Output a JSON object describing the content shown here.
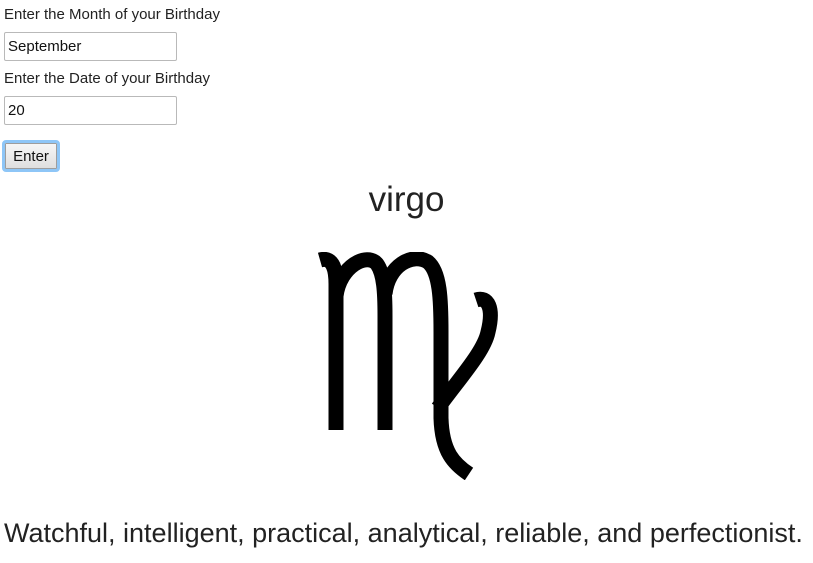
{
  "form": {
    "month_label": "Enter the Month of your Birthday",
    "month_value": "September",
    "date_label": "Enter the Date of your Birthday",
    "date_value": "20",
    "enter_label": "Enter"
  },
  "result": {
    "sign_name": "virgo",
    "symbol_icon": "virgo-zodiac-icon",
    "description": "Watchful, intelligent, practical, analytical, reliable, and perfectionist."
  }
}
